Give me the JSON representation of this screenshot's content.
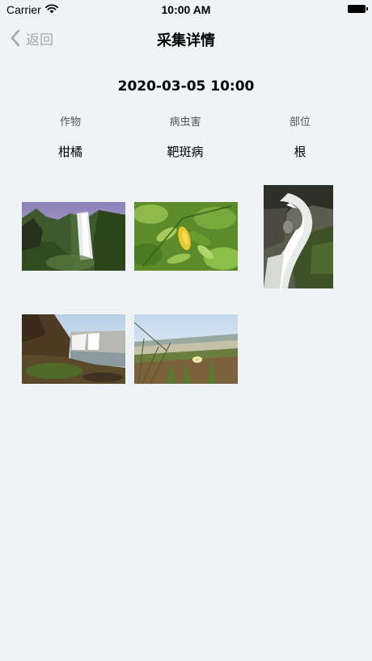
{
  "status_bar": {
    "carrier": "Carrier",
    "time": "10:00 AM"
  },
  "nav": {
    "back_label": "返回",
    "title": "采集详情"
  },
  "record": {
    "datetime": "2020-03-05 10:00",
    "fields": [
      {
        "label": "作物",
        "value": "柑橘"
      },
      {
        "label": "病虫害",
        "value": "靶斑病"
      },
      {
        "label": "部位",
        "value": "根"
      }
    ]
  },
  "photos": [
    {
      "subject": "waterfall-cliff"
    },
    {
      "subject": "citrus-leaves"
    },
    {
      "subject": "stream-rocks"
    },
    {
      "subject": "waterfall-shore"
    },
    {
      "subject": "beach-grass"
    }
  ]
}
